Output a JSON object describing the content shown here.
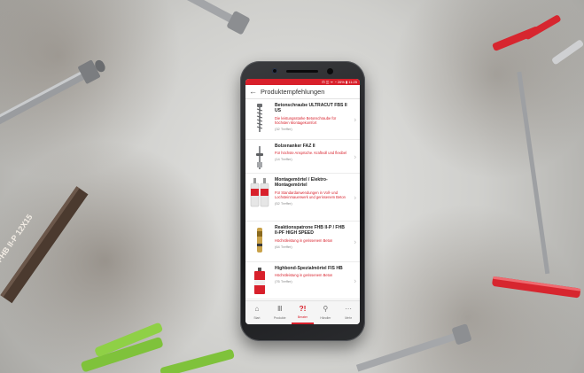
{
  "colors": {
    "accent": "#d8202b",
    "phone_body": "#1c1d1f",
    "background": "#d4d4d2"
  },
  "props": {
    "anchor_label": "FHB II-P 12X15"
  },
  "phone": {
    "status_bar": {
      "text": "⊡ ◫ ᯤ ◔ 26% ▮ 11:25"
    },
    "app_bar": {
      "back_icon": "arrow-left-icon",
      "title": "Produktempfehlungen"
    },
    "products": [
      {
        "name": "Betonschraube ULTRACUT FBS II US",
        "description": "Die leistungsstarke Betonschraube für höchsten Montagekomfort",
        "hits": "(32 Treffer)",
        "icon": "concrete-screw-icon"
      },
      {
        "name": "Bolzenanker FAZ II",
        "description": "Für höchste Ansprüche. Kraftvoll und flexibel",
        "hits": "(14 Treffer)",
        "icon": "bolt-anchor-icon"
      },
      {
        "name": "Montagemörtel / Elektro-Montagemörtel",
        "description": "Für Standardanwendungen in Voll- und Lochsteinmauerwerk und gerissenem Beton",
        "hits": "(52 Treffer)",
        "icon": "mortar-cartridge-icon"
      },
      {
        "name": "Reaktionspatrone FHB II-P / FHB II-PF HIGH SPEED",
        "description": "Höchstleistung in gerissenem Beton",
        "hits": "(64 Treffer)",
        "icon": "reaction-cartridge-icon"
      },
      {
        "name": "Highbond-Spezialmörtel FIS HB",
        "description": "Höchstleistung in gerissenem Beton",
        "hits": "(76 Treffer)",
        "icon": "injection-mortar-icon"
      }
    ],
    "tabs": [
      {
        "label": "Start",
        "icon": "home-icon",
        "active": false
      },
      {
        "label": "Produkte",
        "icon": "products-icon",
        "active": false
      },
      {
        "label": "Berater",
        "icon": "advisor-icon",
        "active": true
      },
      {
        "label": "Händler",
        "icon": "location-pin-icon",
        "active": false
      },
      {
        "label": "Mehr",
        "icon": "more-icon",
        "active": false
      }
    ]
  }
}
